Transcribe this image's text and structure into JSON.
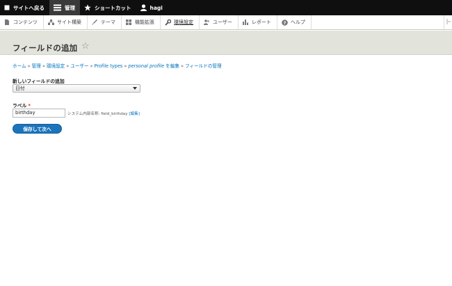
{
  "toolbar": {
    "back_label": "サイトへ戻る",
    "manage_label": "管理",
    "shortcuts_label": "ショートカット",
    "user_label": "hagi"
  },
  "tray": {
    "items": [
      {
        "label": "コンテンツ",
        "icon": "content-icon"
      },
      {
        "label": "サイト構築",
        "icon": "structure-icon"
      },
      {
        "label": "テーマ",
        "icon": "appearance-icon"
      },
      {
        "label": "機能拡張",
        "icon": "extend-icon"
      },
      {
        "label": "環境設定",
        "icon": "config-icon"
      },
      {
        "label": "ユーザー",
        "icon": "people-icon"
      },
      {
        "label": "レポート",
        "icon": "reports-icon"
      },
      {
        "label": "ヘルプ",
        "icon": "help-icon"
      }
    ]
  },
  "page": {
    "title": "フィールドの追加"
  },
  "breadcrumb": {
    "home": "ホーム",
    "admin": "管理",
    "config": "環境設定",
    "people": "ユーザー",
    "profile_types": "Profile types",
    "profile_name": "personal profile",
    "edit_suffix": " を編集",
    "manage_fields": "フィールドの管理"
  },
  "form": {
    "new_field_label": "新しいフィールドの追加",
    "new_field_value": "日付",
    "label_label": "ラベル",
    "required_mark": "*",
    "label_value": "birthday",
    "machine_name_prefix": "システム内部名称: field_birthday",
    "machine_name_edit": "[編集]",
    "submit_label": "保存して次へ"
  },
  "colors": {
    "toolbar_bg": "#0f0f0f",
    "header_bg": "#e2e4dc",
    "link": "#0074bd",
    "button": "#1c74bc"
  }
}
